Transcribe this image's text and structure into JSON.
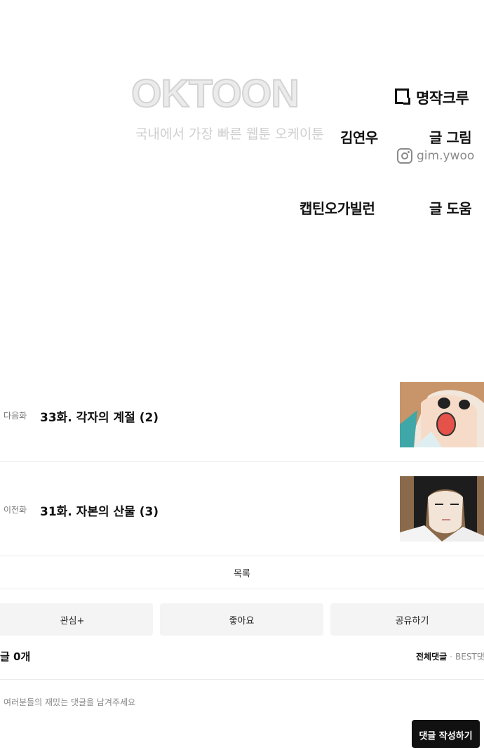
{
  "credits": {
    "watermark_logo": "OKTOON",
    "watermark_tagline": "국내에서 가장 빠른 웹툰 오케이툰",
    "crew_name": "명작크루",
    "crew_icon": "crew-logo-icon",
    "art_author": "김연우",
    "art_role": "글 그림",
    "instagram_icon": "instagram-icon",
    "instagram_handle": "gim.ywoo",
    "assist_author": "캡틴오가빌런",
    "assist_role": "글 도움"
  },
  "episodes": {
    "next": {
      "kind": "다음화",
      "title": "33화. 각자의 계절 (2)"
    },
    "prev": {
      "kind": "이전화",
      "title": "31화. 자본의 산물 (3)"
    }
  },
  "list_label": "목록",
  "actions": {
    "subscribe": "관심+",
    "like": "좋아요",
    "share": "공유하기"
  },
  "comments": {
    "count_label": "글 0개",
    "tab_all": "전체댓글",
    "separator": "·",
    "tab_best": "BEST댓",
    "placeholder": "여러분들의 재밌는 댓글을 남겨주세요",
    "submit_label": "댓글 작성하기"
  }
}
